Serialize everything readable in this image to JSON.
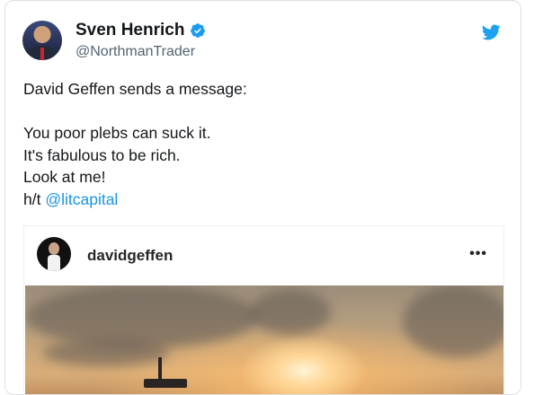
{
  "tweet": {
    "author_name": "Sven Henrich",
    "handle": "@NorthmanTrader",
    "lines": [
      "David Geffen sends a message:",
      "",
      "You poor plebs can suck it.",
      "It's fabulous to be rich.",
      "Look at me!"
    ],
    "ht_prefix": "h/t ",
    "ht_link": "@litcapital"
  },
  "embed": {
    "username": "davidgeffen",
    "more_label": "•••"
  },
  "colors": {
    "link": "#1b95e0",
    "verified": "#1d9bf0",
    "twitter_blue": "#1da1f2"
  },
  "icons": {
    "verified": "verified-badge-icon",
    "brand": "twitter-bird-icon",
    "more": "more-options-icon"
  }
}
